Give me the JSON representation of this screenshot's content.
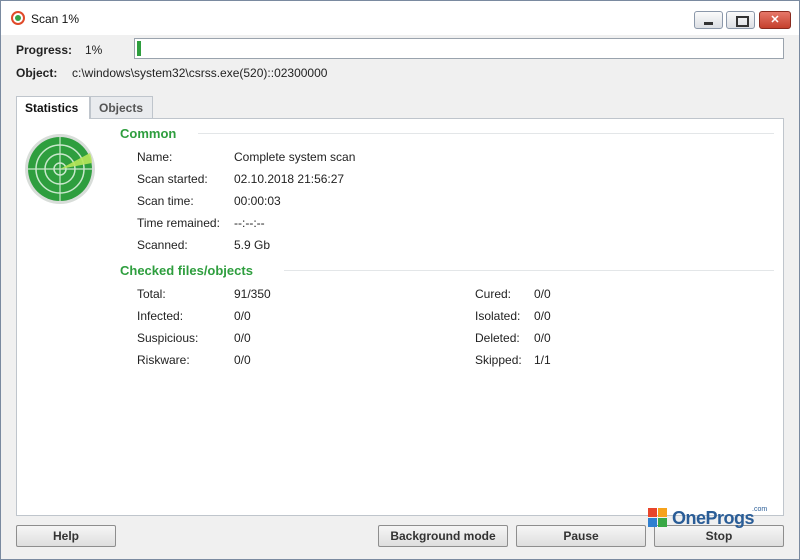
{
  "window": {
    "title": "Scan 1%"
  },
  "progress": {
    "label": "Progress:",
    "percent_text": "1%",
    "fraction": 0.01
  },
  "object": {
    "label": "Object:",
    "value": "c:\\windows\\system32\\csrss.exe(520)::02300000"
  },
  "tabs": [
    {
      "label": "Statistics",
      "active": true
    },
    {
      "label": "Objects",
      "active": false
    }
  ],
  "common": {
    "title": "Common",
    "rows": [
      {
        "label": "Name:",
        "value": "Complete system scan"
      },
      {
        "label": "Scan started:",
        "value": "02.10.2018 21:56:27"
      },
      {
        "label": "Scan time:",
        "value": "00:00:03"
      },
      {
        "label": "Time remained:",
        "value": "--:--:--"
      },
      {
        "label": "Scanned:",
        "value": "5.9 Gb"
      }
    ]
  },
  "checked": {
    "title": "Checked files/objects",
    "left": [
      {
        "label": "Total:",
        "value": "91/350"
      },
      {
        "label": "Infected:",
        "value": "0/0"
      },
      {
        "label": "Suspicious:",
        "value": "0/0"
      },
      {
        "label": "Riskware:",
        "value": "0/0"
      }
    ],
    "right": [
      {
        "label": "Cured:",
        "value": "0/0"
      },
      {
        "label": "Isolated:",
        "value": "0/0"
      },
      {
        "label": "Deleted:",
        "value": "0/0"
      },
      {
        "label": "Skipped:",
        "value": "1/1"
      }
    ]
  },
  "buttons": {
    "help": "Help",
    "background": "Background mode",
    "pause": "Pause",
    "stop": "Stop"
  },
  "watermark": {
    "text": "OneProgs",
    "suffix": ".com"
  },
  "colors": {
    "accent": "#2e9e3e",
    "radar_green": "#2e9e3e"
  },
  "icons": {
    "radar": "radar-icon",
    "app": "app-icon"
  }
}
